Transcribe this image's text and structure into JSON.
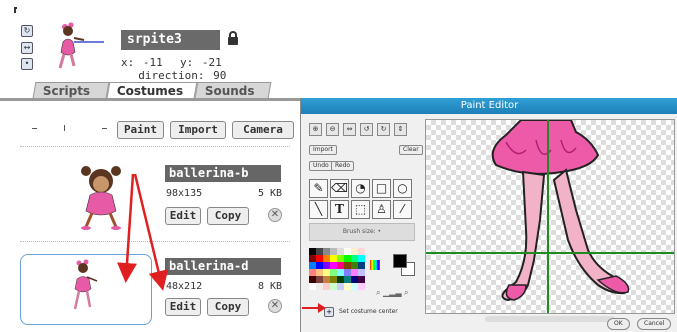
{
  "sprite": {
    "name": "srpite3",
    "x_label": "x:",
    "x": "-11",
    "y_label": "y:",
    "y": "-21",
    "direction_label": "direction:",
    "direction": "90"
  },
  "tabs": [
    {
      "label": "Scripts"
    },
    {
      "label": "Costumes"
    },
    {
      "label": "Sounds"
    }
  ],
  "costumes_toolbar": {
    "paint": "Paint",
    "import": "Import",
    "camera": "Camera"
  },
  "costumes": [
    {
      "name": "ballerina-b",
      "size": "98x135",
      "filesize": "5 KB",
      "edit": "Edit",
      "copy": "Copy"
    },
    {
      "name": "ballerina-d",
      "size": "48x212",
      "filesize": "8 KB",
      "edit": "Edit",
      "copy": "Copy"
    }
  ],
  "paint_editor": {
    "title": "Paint Editor",
    "import": "Import",
    "clear": "Clear",
    "undo": "Undo",
    "redo": "Redo",
    "brush_size": "Brush size:",
    "set_center": "Set costume center",
    "ok": "OK",
    "cancel": "Cancel"
  },
  "colors": {
    "accent_arrow": "#e02020",
    "title_bar": "#2f9fd5",
    "name_field": "#6a6a6a",
    "crosshair": "#1e8c1e"
  }
}
